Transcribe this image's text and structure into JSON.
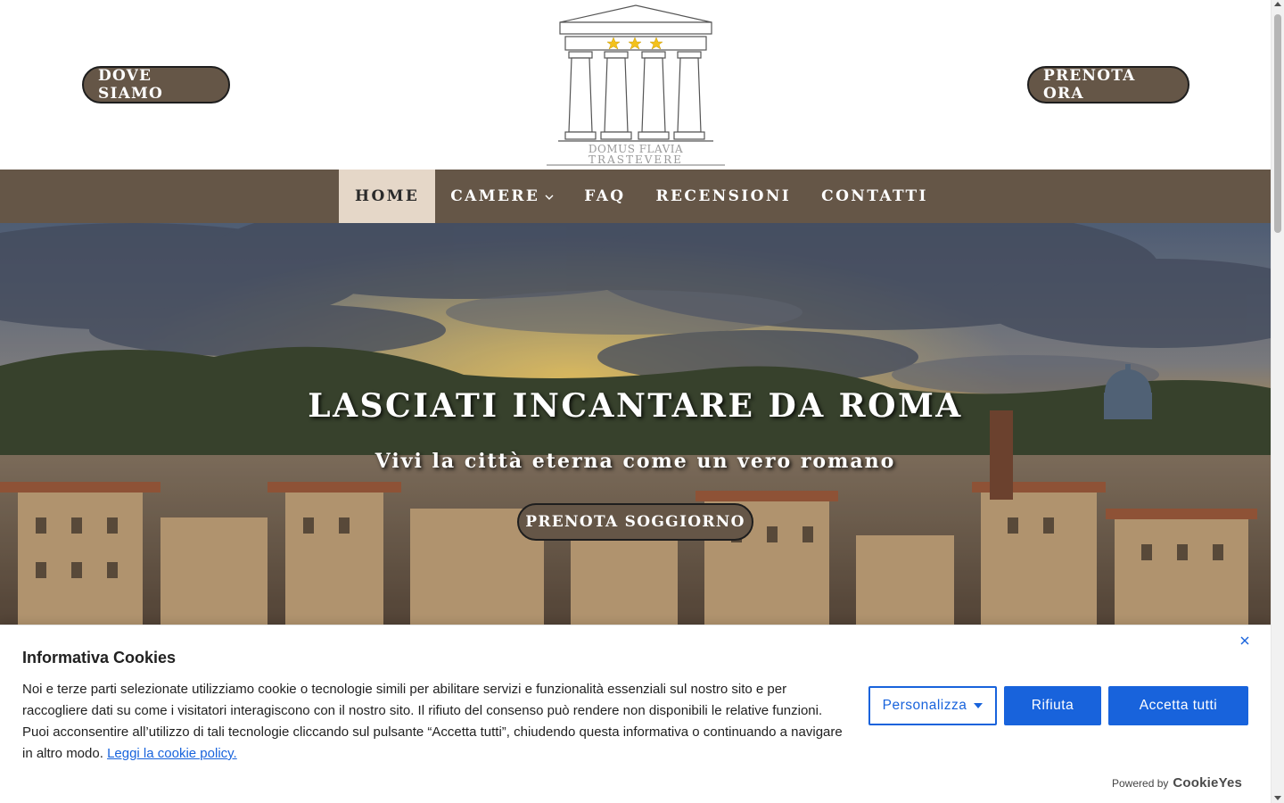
{
  "header": {
    "left_button": "DOVE SIAMO",
    "right_button": "PRENOTA ORA",
    "logo": {
      "line1": "DOMUS FLAVIA",
      "line2": "TRASTEVERE",
      "stars": 3
    }
  },
  "nav": {
    "items": [
      {
        "label": "HOME",
        "active": true
      },
      {
        "label": "CAMERE",
        "has_dropdown": true
      },
      {
        "label": "FAQ"
      },
      {
        "label": "RECENSIONI"
      },
      {
        "label": "CONTATTI"
      }
    ]
  },
  "hero": {
    "title": "LASCIATI INCANTARE DA ROMA",
    "subtitle": "Vivi la città eterna come un vero romano",
    "button": "PRENOTA SOGGIORNO"
  },
  "cookie_banner": {
    "title": "Informativa Cookies",
    "text": "Noi e terze parti selezionate utilizziamo cookie o tecnologie simili per abilitare servizi e funzionalità essenziali sul nostro sito e per raccogliere dati su come i visitatori interagiscono con il nostro sito. Il rifiuto del consenso può rendere non disponibili le relative funzioni. Puoi acconsentire all’utilizzo di tali tecnologie cliccando sul pulsante “Accetta tutti”, chiudendo questa informativa o continuando a navigare in altro modo.",
    "link": "Leggi la cookie policy.",
    "buttons": {
      "customize": "Personalizza",
      "reject": "Rifiuta",
      "accept": "Accetta tutti"
    },
    "powered_by": "Powered by",
    "powered_brand": "CookieYes"
  },
  "colors": {
    "brown": "#655647",
    "nav_active_bg": "#e5d7c8",
    "cookie_blue": "#1863dc"
  }
}
